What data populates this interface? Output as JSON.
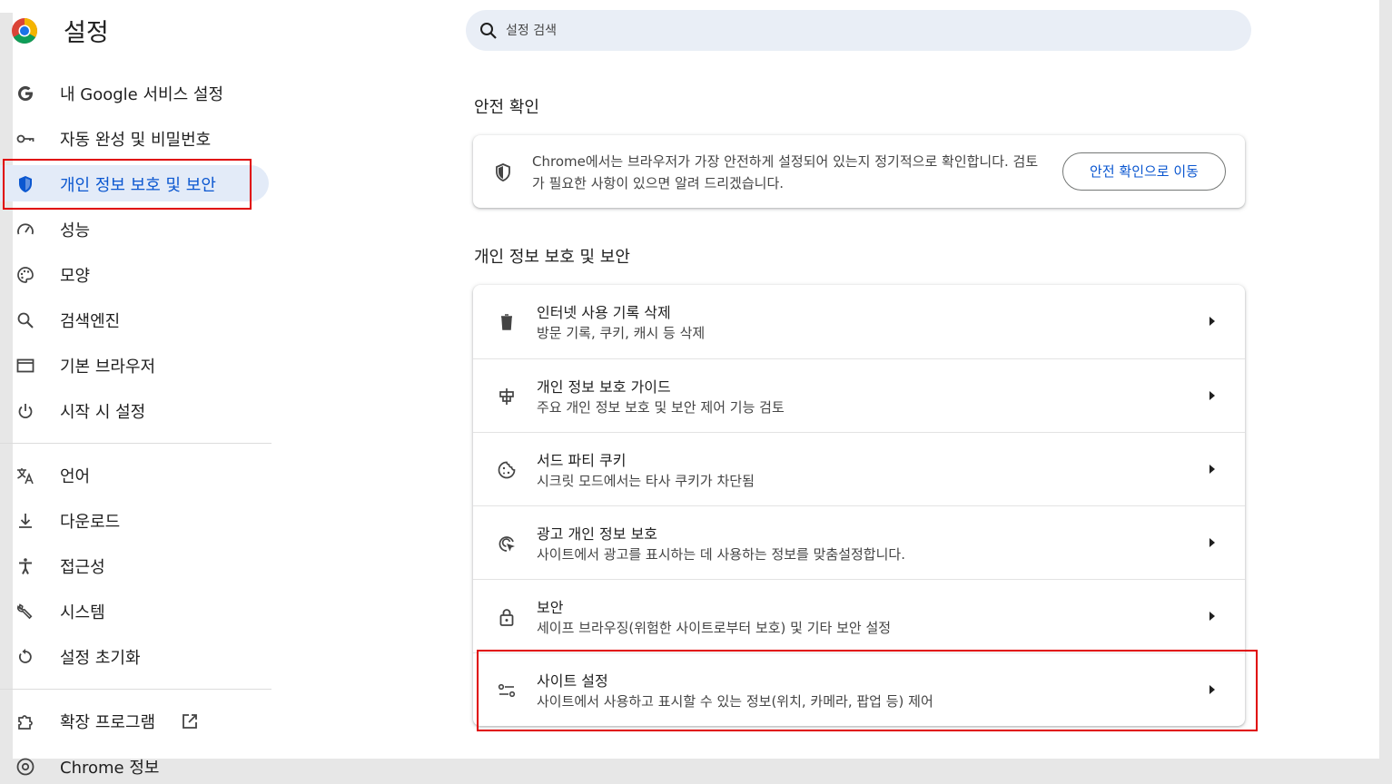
{
  "header": {
    "title": "설정"
  },
  "search": {
    "placeholder": "설정 검색"
  },
  "sidebar": {
    "items": [
      {
        "label": "내 Google 서비스 설정",
        "icon": "google-g-icon"
      },
      {
        "label": "자동 완성 및 비밀번호",
        "icon": "key-icon"
      },
      {
        "label": "개인 정보 보호 및 보안",
        "icon": "shield-icon"
      },
      {
        "label": "성능",
        "icon": "speedometer-icon"
      },
      {
        "label": "모양",
        "icon": "palette-icon"
      },
      {
        "label": "검색엔진",
        "icon": "search-icon"
      },
      {
        "label": "기본 브라우저",
        "icon": "browser-window-icon"
      },
      {
        "label": "시작 시 설정",
        "icon": "power-icon"
      },
      {
        "label": "언어",
        "icon": "translate-icon"
      },
      {
        "label": "다운로드",
        "icon": "download-icon"
      },
      {
        "label": "접근성",
        "icon": "accessibility-icon"
      },
      {
        "label": "시스템",
        "icon": "wrench-icon"
      },
      {
        "label": "설정 초기화",
        "icon": "reset-icon"
      },
      {
        "label": "확장 프로그램",
        "icon": "extension-icon"
      },
      {
        "label": "Chrome 정보",
        "icon": "chrome-icon"
      }
    ]
  },
  "safety_check": {
    "heading": "안전 확인",
    "text": "Chrome에서는 브라우저가 가장 안전하게 설정되어 있는지 정기적으로 확인합니다. 검토가 필요한 사항이 있으면 알려 드리겠습니다.",
    "button": "안전 확인으로 이동"
  },
  "privacy": {
    "heading": "개인 정보 보호 및 보안",
    "rows": [
      {
        "title": "인터넷 사용 기록 삭제",
        "subtitle": "방문 기록, 쿠키, 캐시 등 삭제",
        "icon": "trash-icon"
      },
      {
        "title": "개인 정보 보호 가이드",
        "subtitle": "주요 개인 정보 보호 및 보안 제어 기능 검토",
        "icon": "privacy-guide-icon"
      },
      {
        "title": "서드 파티 쿠키",
        "subtitle": "시크릿 모드에서는 타사 쿠키가 차단됨",
        "icon": "cookie-icon"
      },
      {
        "title": "광고 개인 정보 보호",
        "subtitle": "사이트에서 광고를 표시하는 데 사용하는 정보를 맞춤설정합니다.",
        "icon": "ad-privacy-icon"
      },
      {
        "title": "보안",
        "subtitle": "세이프 브라우징(위험한 사이트로부터 보호) 및 기타 보안 설정",
        "icon": "lock-icon"
      },
      {
        "title": "사이트 설정",
        "subtitle": "사이트에서 사용하고 표시할 수 있는 정보(위치, 카메라, 팝업 등) 제어",
        "icon": "tune-icon"
      }
    ]
  },
  "colors": {
    "accent": "#0b57d0",
    "highlight": "#e00000",
    "active_bg": "#e3ebf8"
  }
}
